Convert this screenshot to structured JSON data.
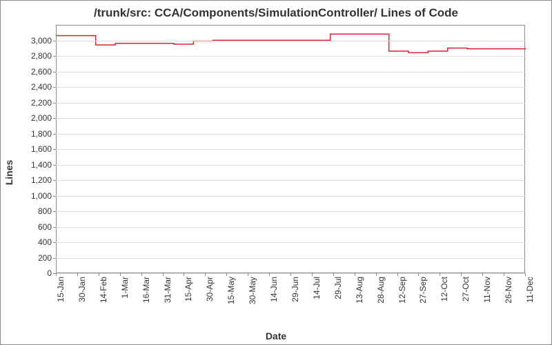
{
  "chart_data": {
    "type": "line",
    "title": "/trunk/src: CCA/Components/SimulationController/ Lines of Code",
    "xlabel": "Date",
    "ylabel": "Lines",
    "ylim": [
      0,
      3200
    ],
    "yticks": [
      0,
      200,
      400,
      600,
      800,
      1000,
      1200,
      1400,
      1600,
      1800,
      2000,
      2200,
      2400,
      2600,
      2800,
      3000
    ],
    "xticks": [
      "15-Jan",
      "30-Jan",
      "14-Feb",
      "1-Mar",
      "16-Mar",
      "31-Mar",
      "15-Apr",
      "30-Apr",
      "15-May",
      "30-May",
      "14-Jun",
      "29-Jun",
      "14-Jul",
      "29-Jul",
      "13-Aug",
      "28-Aug",
      "12-Sep",
      "27-Sep",
      "12-Oct",
      "27-Oct",
      "11-Nov",
      "26-Nov",
      "11-Dec"
    ],
    "x_index": [
      0,
      1,
      2,
      3,
      4,
      5,
      6,
      7,
      8,
      9,
      10,
      11,
      12,
      13,
      14,
      15,
      16,
      17,
      18,
      19,
      20,
      21,
      22,
      23,
      24
    ],
    "values": [
      3070,
      3070,
      2950,
      2970,
      2970,
      2970,
      2960,
      3000,
      3010,
      3010,
      3010,
      3010,
      3010,
      3010,
      3090,
      3090,
      3090,
      2870,
      2850,
      2870,
      2910,
      2900,
      2900,
      2900,
      2910
    ],
    "line_color": "#d9232e"
  }
}
